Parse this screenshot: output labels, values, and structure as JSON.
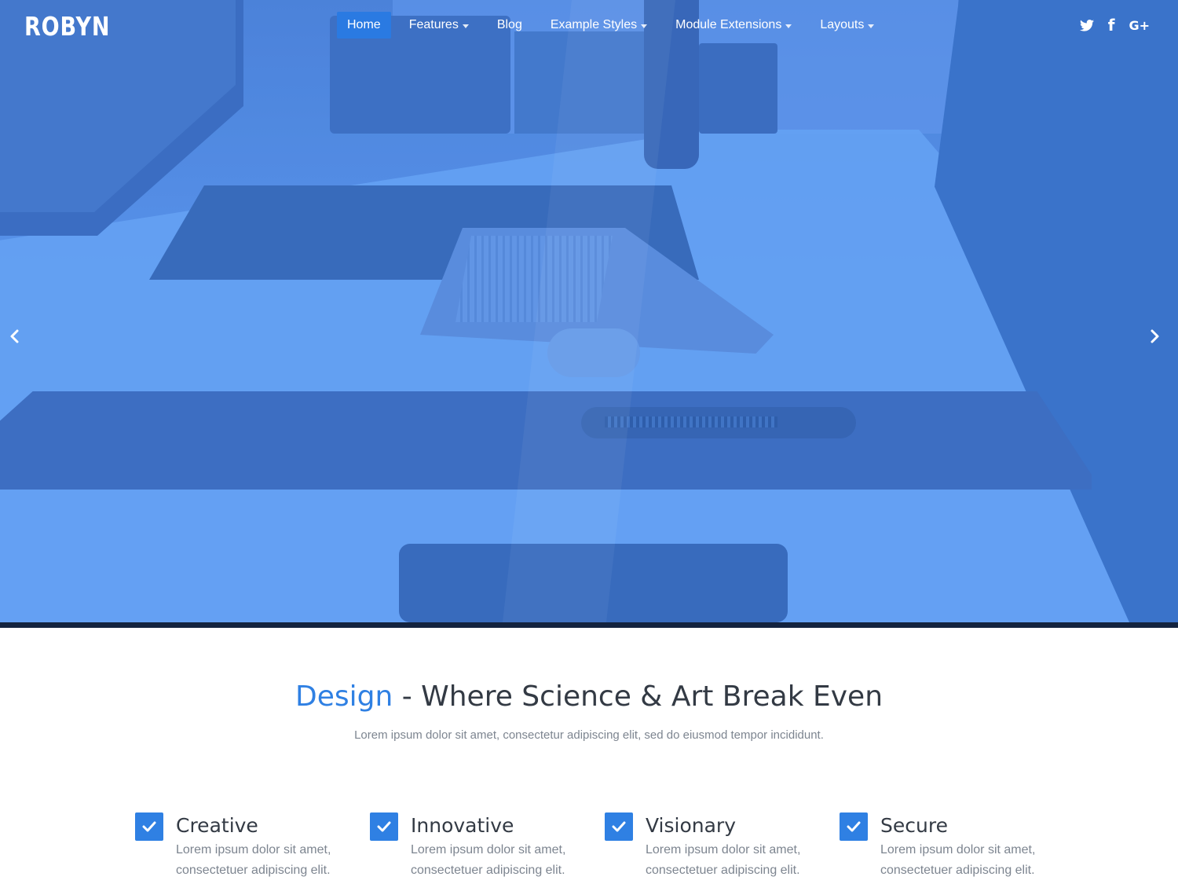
{
  "brand": {
    "logo_text": "ROBYN"
  },
  "nav": {
    "items": [
      {
        "label": "Home",
        "active": true,
        "has_dropdown": false
      },
      {
        "label": "Features",
        "active": false,
        "has_dropdown": true
      },
      {
        "label": "Blog",
        "active": false,
        "has_dropdown": false
      },
      {
        "label": "Example Styles",
        "active": false,
        "has_dropdown": true
      },
      {
        "label": "Module Extensions",
        "active": false,
        "has_dropdown": true
      },
      {
        "label": "Layouts",
        "active": false,
        "has_dropdown": true
      }
    ]
  },
  "social": {
    "twitter_icon": "twitter-icon",
    "facebook_icon": "facebook-icon",
    "facebook_glyph": "f",
    "googleplus_icon": "google-plus-icon",
    "googleplus_glyph": "G+"
  },
  "slider": {
    "prev_icon": "chevron-left-icon",
    "next_icon": "chevron-right-icon"
  },
  "intro": {
    "headline_accent": "Design",
    "headline_rest": " - Where Science & Art Break Even",
    "subline": "Lorem ipsum dolor sit amet, consectetur adipiscing elit, sed do eiusmod tempor incididunt."
  },
  "features": [
    {
      "title": "Creative",
      "description": "Lorem ipsum dolor sit amet, consectetuer adipiscing elit."
    },
    {
      "title": "Innovative",
      "description": "Lorem ipsum dolor sit amet, consectetuer adipiscing elit."
    },
    {
      "title": "Visionary",
      "description": "Lorem ipsum dolor sit amet, consectetuer adipiscing elit."
    },
    {
      "title": "Secure",
      "description": "Lorem ipsum dolor sit amet, consectetuer adipiscing elit."
    }
  ],
  "colors": {
    "accent": "#2f80e3",
    "hero_tint": "#5b93e8",
    "hero_bottom_bar": "#13233f",
    "heading_text": "#333a44",
    "body_text": "#7d8590"
  }
}
